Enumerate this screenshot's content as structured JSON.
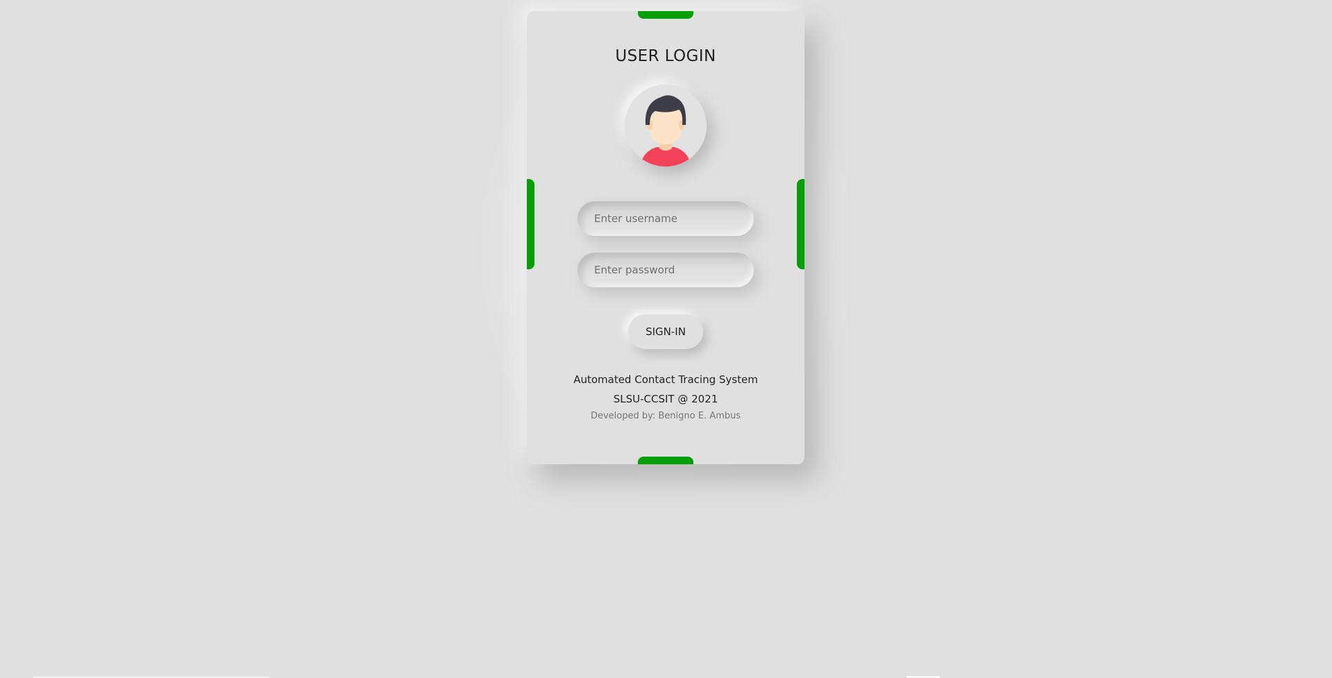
{
  "login": {
    "title": "USER LOGIN",
    "username_placeholder": "Enter username",
    "password_placeholder": "Enter password",
    "signin_label": "SIGN-IN",
    "system_name": "Automated Contact Tracing System",
    "copyright": "SLSU-CCSIT @ 2021",
    "developer": "Developed by: Benigno E. Ambus"
  },
  "icons": {
    "avatar": "user-avatar-icon"
  },
  "colors": {
    "background": "#e0e0e0",
    "accent": "#06a006",
    "shirt": "#f24358",
    "hair": "#3e3e48",
    "skin": "#fde3c8"
  }
}
